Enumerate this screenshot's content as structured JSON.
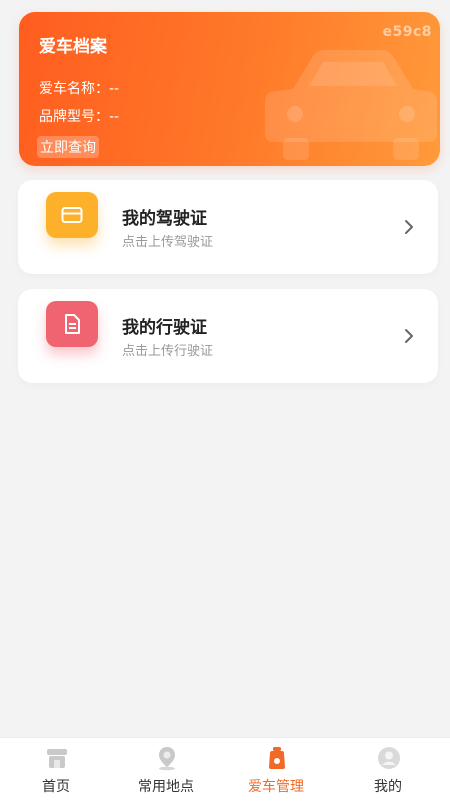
{
  "watermark": "e59c8",
  "car_profile": {
    "title": "爱车档案",
    "name_row": "爱车名称：--",
    "model_row": "品牌型号：--",
    "query_link": "立即查询",
    "icon": "car-silhouette-icon"
  },
  "licenses": [
    {
      "title": "我的驾驶证",
      "subtitle": "点击上传驾驶证",
      "icon": "card-icon",
      "color": "#fdb02a"
    },
    {
      "title": "我的行驶证",
      "subtitle": "点击上传行驶证",
      "icon": "document-icon",
      "color": "#f06370"
    }
  ],
  "tabbar": {
    "items": [
      {
        "label": "首页",
        "icon": "home-icon",
        "active": false
      },
      {
        "label": "常用地点",
        "icon": "location-pin-icon",
        "active": false
      },
      {
        "label": "爱车管理",
        "icon": "car-manage-icon",
        "active": true
      },
      {
        "label": "我的",
        "icon": "user-avatar-icon",
        "active": false
      }
    ]
  },
  "colors": {
    "accent": "#f26a28",
    "card_gradient_start": "#ff5d1f",
    "card_gradient_end": "#ff9a3a",
    "background": "#f3f3f3"
  }
}
